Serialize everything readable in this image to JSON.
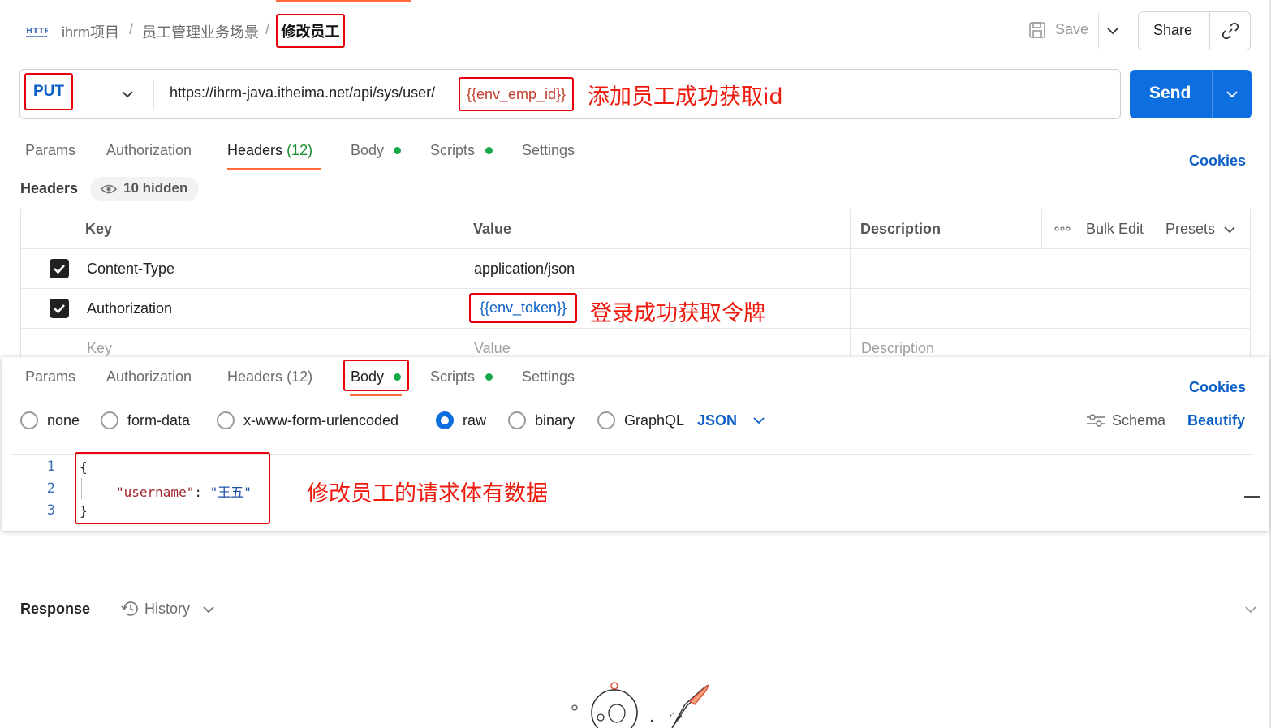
{
  "breadcrumb": {
    "project": "ihrm项目",
    "folder": "员工管理业务场景",
    "separator": "/",
    "current": "修改员工",
    "http_icon": "HTTP"
  },
  "header": {
    "save_label": "Save",
    "share_label": "Share"
  },
  "request": {
    "method": "PUT",
    "url_prefix": "https://ihrm-java.itheima.net/api/sys/user/",
    "url_variable": "{{env_emp_id}}",
    "send_label": "Send"
  },
  "annotations": {
    "url_note": "添加员工成功获取id",
    "token_note": "登录成功获取令牌",
    "body_note": "修改员工的请求体有数据"
  },
  "tabs": {
    "params": "Params",
    "authorization": "Authorization",
    "headers": "Headers",
    "headers_count": "(12)",
    "body": "Body",
    "scripts": "Scripts",
    "settings": "Settings",
    "cookies": "Cookies"
  },
  "headers_section": {
    "title": "Headers",
    "hidden": "10 hidden",
    "columns": {
      "key": "Key",
      "value": "Value",
      "description": "Description"
    },
    "bulk_edit": "Bulk Edit",
    "presets": "Presets",
    "rows": [
      {
        "key": "Content-Type",
        "value": "application/json",
        "checked": true
      },
      {
        "key": "Authorization",
        "value": "{{env_token}}",
        "checked": true
      }
    ],
    "placeholder": {
      "key": "Key",
      "value": "Value",
      "description": "Description"
    }
  },
  "body_section": {
    "modes": [
      "none",
      "form-data",
      "x-www-form-urlencoded",
      "raw",
      "binary",
      "GraphQL"
    ],
    "selected_mode": "raw",
    "format": "JSON",
    "schema": "Schema",
    "beautify": "Beautify",
    "lines": [
      "1",
      "2",
      "3"
    ],
    "code_open": "{",
    "code_key": "\"username\"",
    "code_colon": ": ",
    "code_value": "\"王五\"",
    "code_close": "}"
  },
  "response": {
    "title": "Response",
    "history": "History"
  },
  "colors": {
    "accent": "#ff6c37",
    "primary": "#0d6ee0",
    "annotation": "#e8000b",
    "status_dot": "#18a84a"
  }
}
